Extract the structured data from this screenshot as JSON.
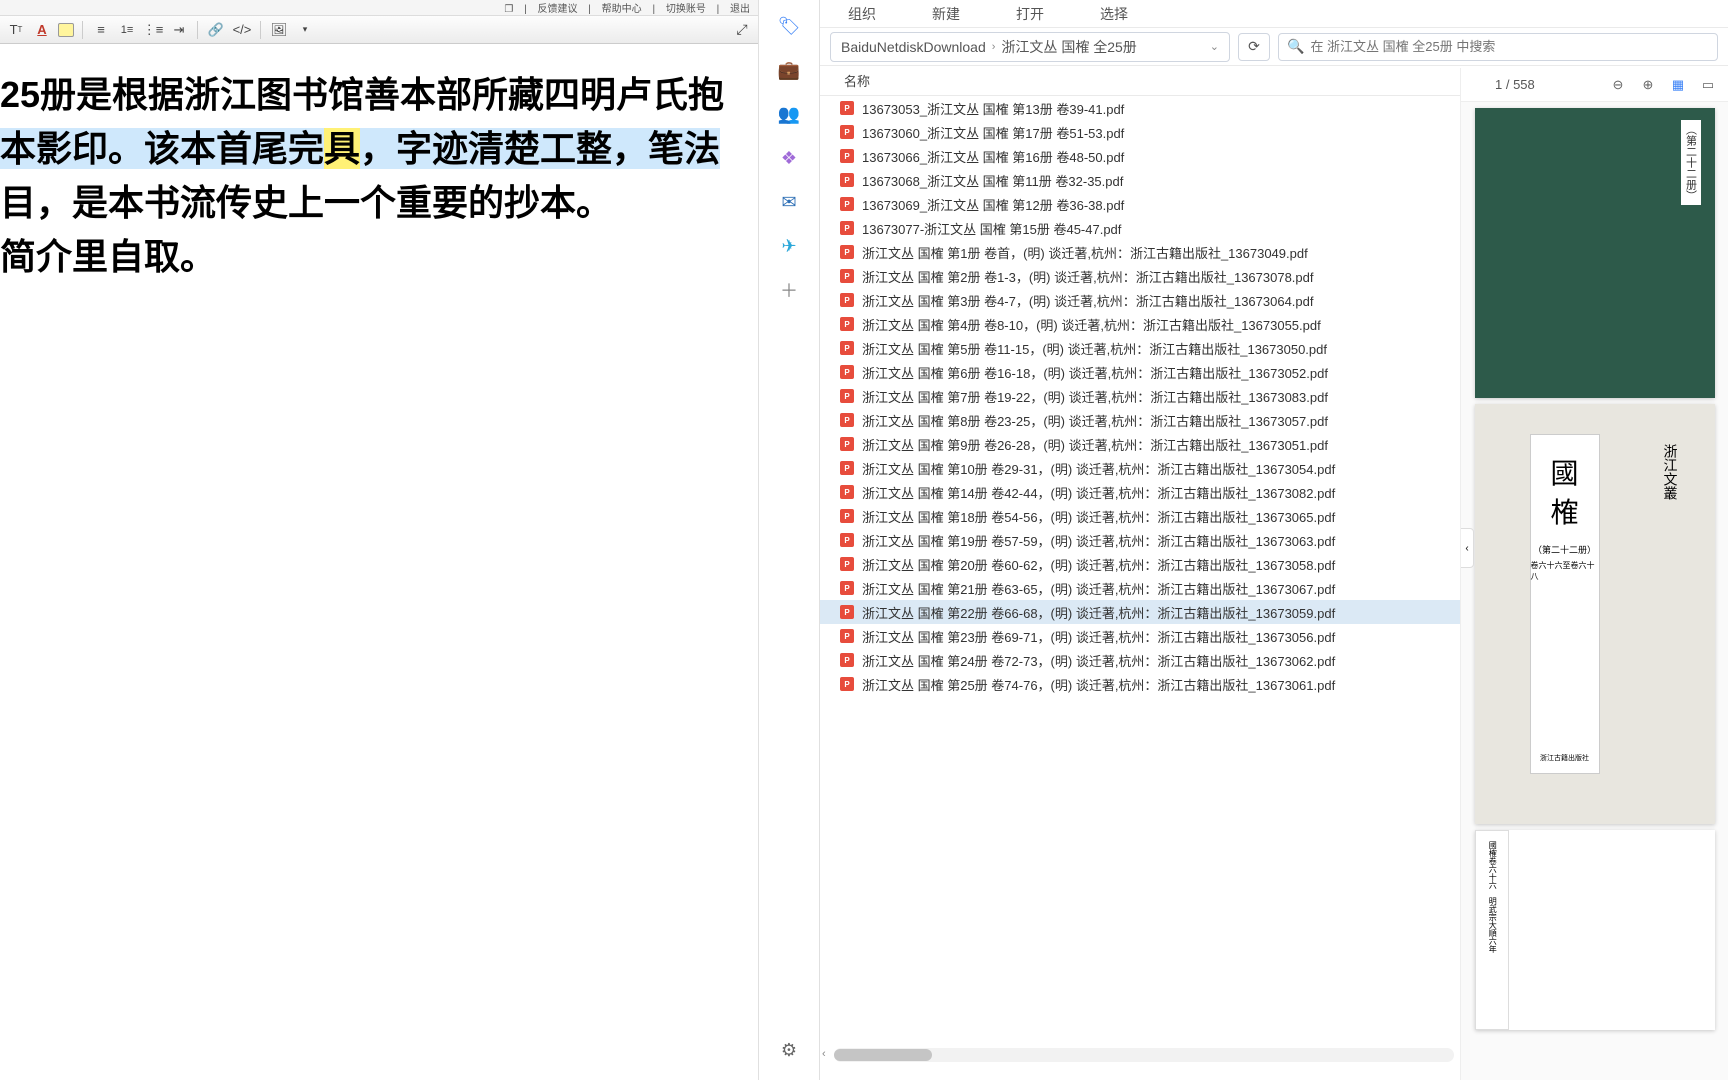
{
  "editor": {
    "topbar": {
      "feedback": "反馈建议",
      "help": "帮助中心",
      "switch": "切换账号",
      "exit": "退出"
    },
    "text_line1a": "25册是根据浙江图书馆善本部所藏四明卢氏抱",
    "text_line2a": "本影印。该本首尾完",
    "text_line2_hl": "具",
    "text_line2b": "，字迹清楚工整，笔法",
    "text_line3": "目，是本书流传史上一个重要的抄本。",
    "text_line4": "简介里自取。"
  },
  "vside": {
    "items": [
      "tag",
      "store",
      "user",
      "office",
      "outlook",
      "telegram",
      "plus"
    ],
    "bottom": "gear"
  },
  "explorer": {
    "tabs": [
      "组织",
      "新建",
      "打开",
      "选择"
    ],
    "breadcrumb": {
      "root": "BaiduNetdiskDownload",
      "folder": "浙江文丛 国榷 全25册"
    },
    "search_placeholder": "在 浙江文丛 国榷 全25册 中搜索",
    "col_name": "名称",
    "files": [
      "13673053_浙江文丛 国榷 第13册 卷39-41.pdf",
      "13673060_浙江文丛 国榷 第17册 卷51-53.pdf",
      "13673066_浙江文丛 国榷 第16册 卷48-50.pdf",
      "13673068_浙江文丛 国榷 第11册 卷32-35.pdf",
      "13673069_浙江文丛 国榷 第12册 卷36-38.pdf",
      "13673077-浙江文丛 国榷 第15册 卷45-47.pdf",
      "浙江文丛 国榷 第1册 卷首，(明) 谈迁著,杭州：浙江古籍出版社_13673049.pdf",
      "浙江文丛 国榷 第2册 卷1-3，(明) 谈迁著,杭州：浙江古籍出版社_13673078.pdf",
      "浙江文丛 国榷 第3册 卷4-7，(明) 谈迁著,杭州：浙江古籍出版社_13673064.pdf",
      "浙江文丛 国榷 第4册 卷8-10，(明) 谈迁著,杭州：浙江古籍出版社_13673055.pdf",
      "浙江文丛 国榷 第5册 卷11-15，(明) 谈迁著,杭州：浙江古籍出版社_13673050.pdf",
      "浙江文丛 国榷 第6册 卷16-18，(明) 谈迁著,杭州：浙江古籍出版社_13673052.pdf",
      "浙江文丛 国榷 第7册 卷19-22，(明) 谈迁著,杭州：浙江古籍出版社_13673083.pdf",
      "浙江文丛 国榷 第8册 卷23-25，(明) 谈迁著,杭州：浙江古籍出版社_13673057.pdf",
      "浙江文丛 国榷 第9册 卷26-28，(明) 谈迁著,杭州：浙江古籍出版社_13673051.pdf",
      "浙江文丛 国榷 第10册 卷29-31，(明) 谈迁著,杭州：浙江古籍出版社_13673054.pdf",
      "浙江文丛 国榷 第14册 卷42-44，(明) 谈迁著,杭州：浙江古籍出版社_13673082.pdf",
      "浙江文丛 国榷 第18册 卷54-56，(明) 谈迁著,杭州：浙江古籍出版社_13673065.pdf",
      "浙江文丛 国榷 第19册 卷57-59，(明) 谈迁著,杭州：浙江古籍出版社_13673063.pdf",
      "浙江文丛 国榷 第20册 卷60-62，(明) 谈迁著,杭州：浙江古籍出版社_13673058.pdf",
      "浙江文丛 国榷 第21册 卷63-65，(明) 谈迁著,杭州：浙江古籍出版社_13673067.pdf",
      "浙江文丛 国榷 第22册 卷66-68，(明) 谈迁著,杭州：浙江古籍出版社_13673059.pdf",
      "浙江文丛 国榷 第23册 卷69-71，(明) 谈迁著,杭州：浙江古籍出版社_13673056.pdf",
      "浙江文丛 国榷 第24册 卷72-73，(明) 谈迁著,杭州：浙江古籍出版社_13673062.pdf",
      "浙江文丛 国榷 第25册 卷74-76，(明) 谈迁著,杭州：浙江古籍出版社_13673061.pdf"
    ],
    "selected_index": 21
  },
  "preview": {
    "page_counter": "1 / 558",
    "cover1_label": "（第二十二册）",
    "cover2_big1": "國",
    "cover2_big2": "榷",
    "cover2_sub": "（第二十二册）",
    "cover2_sub2": "卷六十六至卷六十八",
    "cover2_side": "浙江文叢",
    "cover2_pub": "浙江古籍出版社",
    "text_page_sample": "國榷卷六十六　明武宗大順六年"
  }
}
